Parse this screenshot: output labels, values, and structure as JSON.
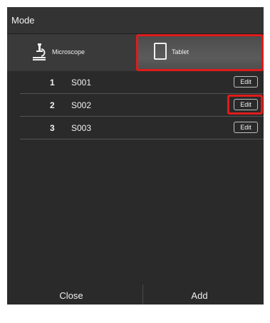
{
  "header": {
    "title": "Mode"
  },
  "tabs": [
    {
      "label": "Microscope",
      "icon": "microscope-icon",
      "selected": false
    },
    {
      "label": "Tablet",
      "icon": "tablet-icon",
      "selected": true
    }
  ],
  "items": [
    {
      "number": "1",
      "name": "S001",
      "edit_label": "Edit"
    },
    {
      "number": "2",
      "name": "S002",
      "edit_label": "Edit"
    },
    {
      "number": "3",
      "name": "S003",
      "edit_label": "Edit"
    }
  ],
  "footer": {
    "close_label": "Close",
    "add_label": "Add"
  },
  "colors": {
    "panel": "#2a2a2a",
    "highlight": "#e01b1b",
    "text": "#f2f2f2"
  }
}
